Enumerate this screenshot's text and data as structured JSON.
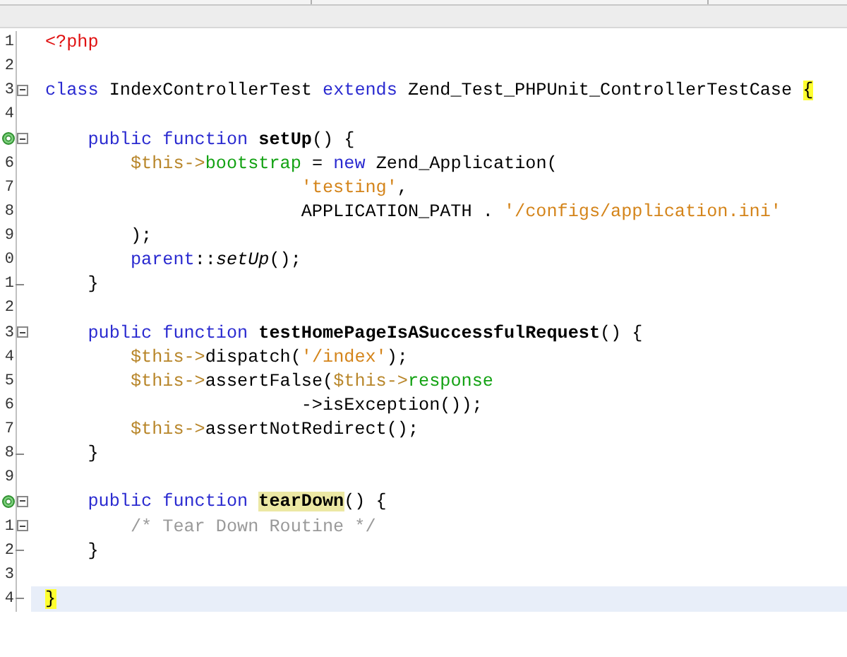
{
  "editor": {
    "lines": [
      {
        "number": "1",
        "fold_start": false,
        "fold_end": false,
        "override": false,
        "current": false,
        "tokens": [
          {
            "text": "<?php",
            "kind": "tag",
            "highlighted": false
          }
        ]
      },
      {
        "number": "2",
        "fold_start": false,
        "fold_end": false,
        "override": false,
        "current": false
      },
      {
        "number": "3",
        "fold_start": true,
        "fold_end": false,
        "override": false,
        "current": false,
        "tokens": [
          {
            "text": "class",
            "kind": "keyword",
            "highlighted": false
          },
          {
            "text": " IndexControllerTest ",
            "kind": "plain",
            "highlighted": false
          },
          {
            "text": "extends",
            "kind": "keyword",
            "highlighted": false
          },
          {
            "text": " Zend_Test_PHPUnit_ControllerTestCase ",
            "kind": "plain",
            "highlighted": false
          },
          {
            "text": "{",
            "kind": "plain",
            "highlighted": true
          }
        ]
      },
      {
        "number": "4",
        "fold_start": false,
        "fold_end": false,
        "override": false,
        "current": false
      },
      {
        "fold_start": true,
        "fold_end": false,
        "override": true,
        "current": false,
        "tokens": [
          {
            "text": "    public function ",
            "kind": "keyword",
            "highlighted": false
          },
          {
            "text": "setUp",
            "kind": "decl",
            "highlighted": false
          },
          {
            "text": "() {",
            "kind": "plain",
            "highlighted": false
          }
        ]
      },
      {
        "number": "6",
        "fold_start": false,
        "fold_end": false,
        "override": false,
        "current": false,
        "tokens": [
          {
            "text": "        $this->",
            "kind": "var",
            "highlighted": false
          },
          {
            "text": "bootstrap",
            "kind": "field",
            "highlighted": false
          },
          {
            "text": " = ",
            "kind": "plain",
            "highlighted": false
          },
          {
            "text": "new",
            "kind": "keyword",
            "highlighted": false
          },
          {
            "text": " Zend_Application(",
            "kind": "plain",
            "highlighted": false
          }
        ]
      },
      {
        "number": "7",
        "fold_start": false,
        "fold_end": false,
        "override": false,
        "current": false,
        "tokens": [
          {
            "text": "                        'testing'",
            "kind": "string",
            "highlighted": false
          },
          {
            "text": ",",
            "kind": "plain",
            "highlighted": false
          }
        ]
      },
      {
        "number": "8",
        "fold_start": false,
        "fold_end": false,
        "override": false,
        "current": false,
        "tokens": [
          {
            "text": "                        APPLICATION_PATH . ",
            "kind": "plain",
            "highlighted": false
          },
          {
            "text": "'/configs/application.ini'",
            "kind": "string",
            "highlighted": false
          }
        ]
      },
      {
        "number": "9",
        "fold_start": false,
        "fold_end": false,
        "override": false,
        "current": false,
        "tokens": [
          {
            "text": "        );",
            "kind": "plain",
            "highlighted": false
          }
        ]
      },
      {
        "number": "0",
        "fold_start": false,
        "fold_end": false,
        "override": false,
        "current": false,
        "tokens": [
          {
            "text": "        parent",
            "kind": "keyword",
            "highlighted": false
          },
          {
            "text": "::",
            "kind": "plain",
            "highlighted": false
          },
          {
            "text": "setUp",
            "kind": "italic",
            "highlighted": false
          },
          {
            "text": "();",
            "kind": "plain",
            "highlighted": false
          }
        ]
      },
      {
        "number": "1",
        "fold_start": false,
        "fold_end": true,
        "override": false,
        "current": false,
        "tokens": [
          {
            "text": "    }",
            "kind": "plain",
            "highlighted": false
          }
        ]
      },
      {
        "number": "2",
        "fold_start": false,
        "fold_end": false,
        "override": false,
        "current": false
      },
      {
        "number": "3",
        "fold_start": true,
        "fold_end": false,
        "override": false,
        "current": false,
        "tokens": [
          {
            "text": "    public function ",
            "kind": "keyword",
            "highlighted": false
          },
          {
            "text": "testHomePageIsASuccessfulRequest",
            "kind": "decl",
            "highlighted": false
          },
          {
            "text": "() {",
            "kind": "plain",
            "highlighted": false
          }
        ]
      },
      {
        "number": "4",
        "fold_start": false,
        "fold_end": false,
        "override": false,
        "current": false,
        "tokens": [
          {
            "text": "        $this->",
            "kind": "var",
            "highlighted": false
          },
          {
            "text": "dispatch(",
            "kind": "plain",
            "highlighted": false
          },
          {
            "text": "'/index'",
            "kind": "string",
            "highlighted": false
          },
          {
            "text": ");",
            "kind": "plain",
            "highlighted": false
          }
        ]
      },
      {
        "number": "5",
        "fold_start": false,
        "fold_end": false,
        "override": false,
        "current": false,
        "tokens": [
          {
            "text": "        $this->",
            "kind": "var",
            "highlighted": false
          },
          {
            "text": "assertFalse(",
            "kind": "plain",
            "highlighted": false
          },
          {
            "text": "$this->",
            "kind": "var",
            "highlighted": false
          },
          {
            "text": "response",
            "kind": "field",
            "highlighted": false
          }
        ]
      },
      {
        "number": "6",
        "fold_start": false,
        "fold_end": false,
        "override": false,
        "current": false,
        "tokens": [
          {
            "text": "                        ->isException());",
            "kind": "plain",
            "highlighted": false
          }
        ]
      },
      {
        "number": "7",
        "fold_start": false,
        "fold_end": false,
        "override": false,
        "current": false,
        "tokens": [
          {
            "text": "        $this->",
            "kind": "var",
            "highlighted": false
          },
          {
            "text": "assertNotRedirect();",
            "kind": "plain",
            "highlighted": false
          }
        ]
      },
      {
        "number": "8",
        "fold_start": false,
        "fold_end": true,
        "override": false,
        "current": false,
        "tokens": [
          {
            "text": "    }",
            "kind": "plain",
            "highlighted": false
          }
        ]
      },
      {
        "number": "9",
        "fold_start": false,
        "fold_end": false,
        "override": false,
        "current": false
      },
      {
        "fold_start": true,
        "fold_end": false,
        "override": true,
        "current": false,
        "tokens": [
          {
            "text": "    public function ",
            "kind": "keyword",
            "highlighted": false
          },
          {
            "text": "tearDown",
            "kind": "decl",
            "highlighted": true
          },
          {
            "text": "() {",
            "kind": "plain",
            "highlighted": false
          }
        ]
      },
      {
        "number": "1",
        "fold_start": true,
        "fold_end": false,
        "override": false,
        "current": false,
        "tokens": [
          {
            "text": "        /* Tear Down Routine */",
            "kind": "comment",
            "highlighted": false
          }
        ]
      },
      {
        "number": "2",
        "fold_start": false,
        "fold_end": true,
        "override": false,
        "current": false,
        "tokens": [
          {
            "text": "    }",
            "kind": "plain",
            "highlighted": false
          }
        ]
      },
      {
        "number": "3",
        "fold_start": false,
        "fold_end": false,
        "override": false,
        "current": false
      },
      {
        "number": "4",
        "fold_start": false,
        "fold_end": true,
        "override": false,
        "current": true,
        "tokens": [
          {
            "text": "}",
            "kind": "plain",
            "highlighted": true
          }
        ]
      }
    ]
  }
}
